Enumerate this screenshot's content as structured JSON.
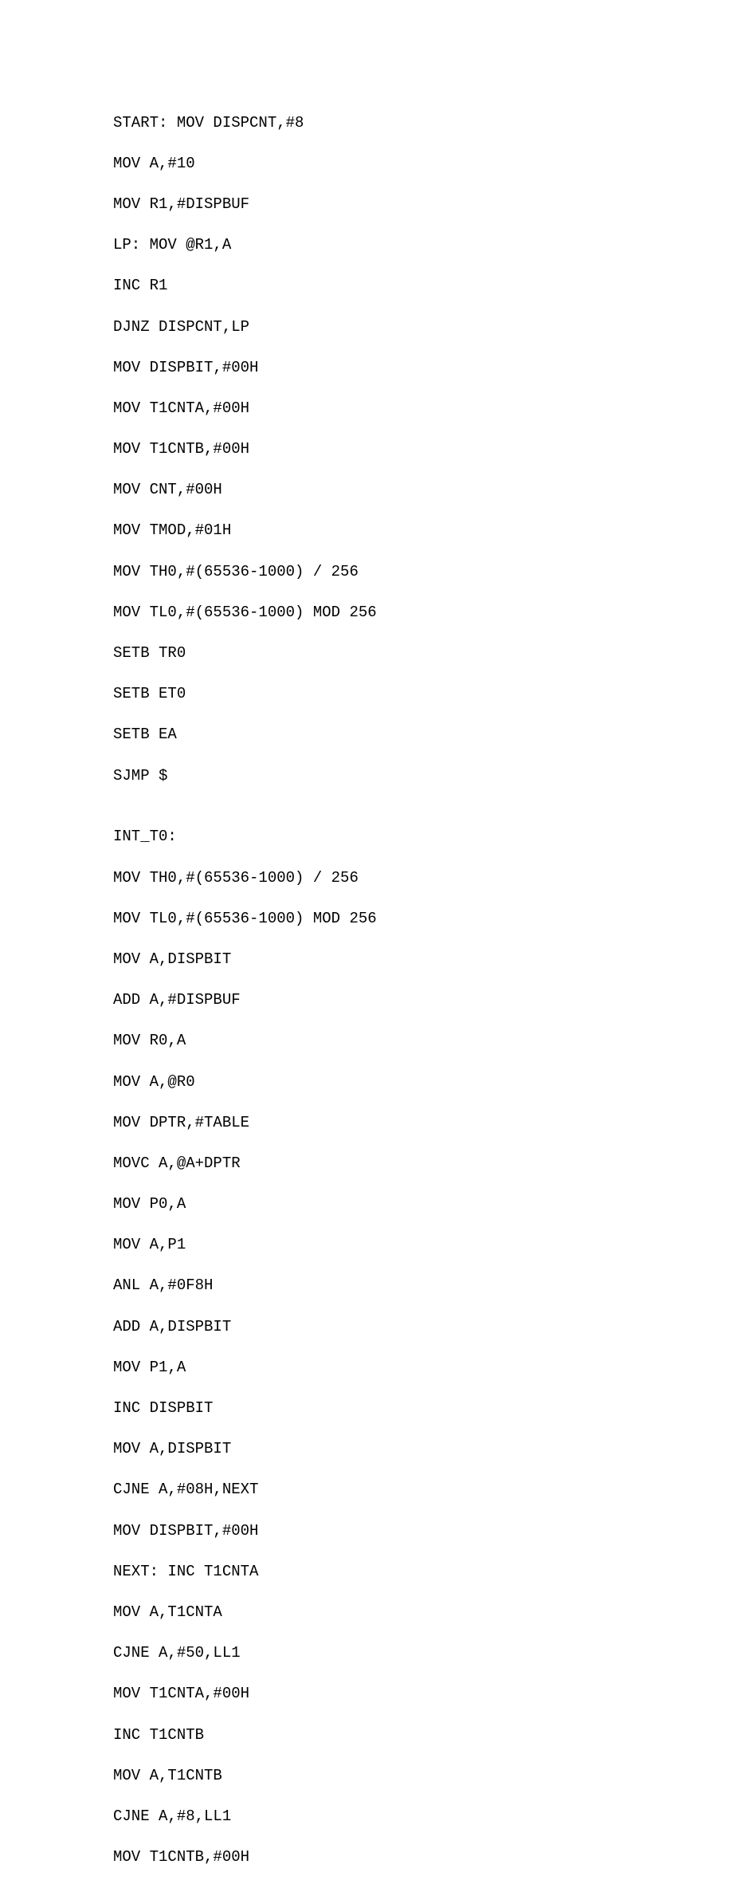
{
  "code": {
    "lines": [
      "START: MOV DISPCNT,#8",
      "MOV A,#10",
      "MOV R1,#DISPBUF",
      "LP: MOV @R1,A",
      "INC R1",
      "DJNZ DISPCNT,LP",
      "MOV DISPBIT,#00H",
      "MOV T1CNTA,#00H",
      "MOV T1CNTB,#00H",
      "MOV CNT,#00H",
      "MOV TMOD,#01H",
      "MOV TH0,#(65536-1000) / 256",
      "MOV TL0,#(65536-1000) MOD 256",
      "SETB TR0",
      "SETB ET0",
      "SETB EA",
      "SJMP $",
      "",
      "INT_T0:",
      "MOV TH0,#(65536-1000) / 256",
      "MOV TL0,#(65536-1000) MOD 256",
      "MOV A,DISPBIT",
      "ADD A,#DISPBUF",
      "MOV R0,A",
      "MOV A,@R0",
      "MOV DPTR,#TABLE",
      "MOVC A,@A+DPTR",
      "MOV P0,A",
      "MOV A,P1",
      "ANL A,#0F8H",
      "ADD A,DISPBIT",
      "MOV P1,A",
      "INC DISPBIT",
      "MOV A,DISPBIT",
      "CJNE A,#08H,NEXT",
      "MOV DISPBIT,#00H",
      "NEXT: INC T1CNTA",
      "MOV A,T1CNTA",
      "CJNE A,#50,LL1",
      "MOV T1CNTA,#00H",
      "INC T1CNTB",
      "MOV A,T1CNTB",
      "CJNE A,#8,LL1",
      "MOV T1CNTB,#00H"
    ]
  }
}
